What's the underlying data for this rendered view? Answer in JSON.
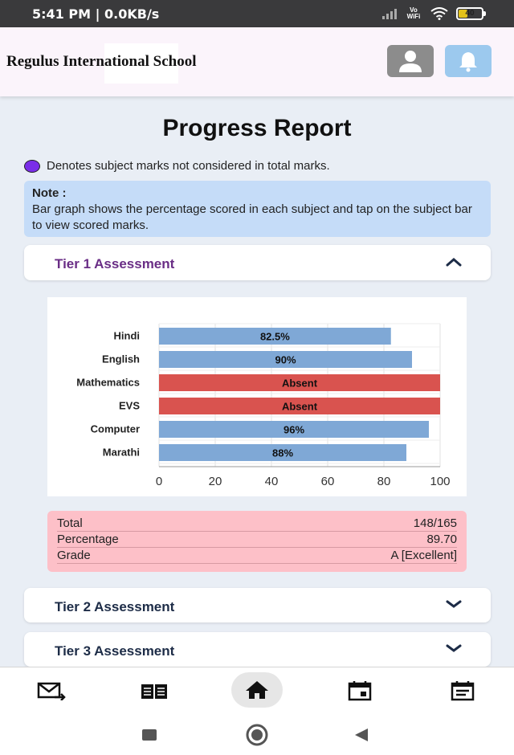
{
  "status_bar": {
    "time_speed": "5:41 PM | 0.0KB/s",
    "network_label": "Vo WiFi",
    "battery_level": "40",
    "icons": [
      "signal-icon",
      "wifi-icon",
      "battery-icon"
    ]
  },
  "header": {
    "school_name": "Regulus International School",
    "profile_icon": "person-icon",
    "notification_icon": "bell-icon"
  },
  "page": {
    "title": "Progress Report",
    "legend_text": "Denotes subject marks not considered in total marks.",
    "legend_color": "#7a2ee8",
    "note_heading": "Note :",
    "note_text": "Bar graph shows the percentage scored in each subject and tap on the subject bar to view scored marks."
  },
  "assessments": [
    {
      "label": "Tier 1 Assessment",
      "expanded": true
    },
    {
      "label": "Tier 2 Assessment",
      "expanded": false
    },
    {
      "label": "Tier 3 Assessment",
      "expanded": false
    }
  ],
  "chart_data": {
    "type": "bar",
    "orientation": "horizontal",
    "categories": [
      "Hindi",
      "English",
      "Mathematics",
      "EVS",
      "Computer",
      "Marathi"
    ],
    "values": [
      82.5,
      90,
      100,
      100,
      96,
      88
    ],
    "bar_labels": [
      "82.5%",
      "90%",
      "Absent",
      "Absent",
      "96%",
      "88%"
    ],
    "bar_colors": [
      "#7fa8d6",
      "#7fa8d6",
      "#d9534f",
      "#d9534f",
      "#7fa8d6",
      "#7fa8d6"
    ],
    "xlim": [
      0,
      100
    ],
    "xticks": [
      "0",
      "20",
      "40",
      "60",
      "80",
      "100"
    ],
    "grid": true
  },
  "summary": {
    "rows": [
      {
        "label": "Total",
        "value": "148/165"
      },
      {
        "label": "Percentage",
        "value": "89.70"
      },
      {
        "label": "Grade",
        "value": "A [Excellent]"
      }
    ],
    "background": "#fdc0c8"
  },
  "bottom_nav": {
    "items": [
      "mail-forward-icon",
      "book-icon",
      "home-icon",
      "calendar-icon",
      "notice-icon"
    ],
    "active": "home-icon"
  },
  "system_nav": {
    "items": [
      "recent-apps-icon",
      "home-circle-icon",
      "back-icon"
    ]
  },
  "colors": {
    "accent_tier1": "#6a2e86",
    "note_bg": "#c5dcf8",
    "bell_button": "#9cc9ee"
  }
}
